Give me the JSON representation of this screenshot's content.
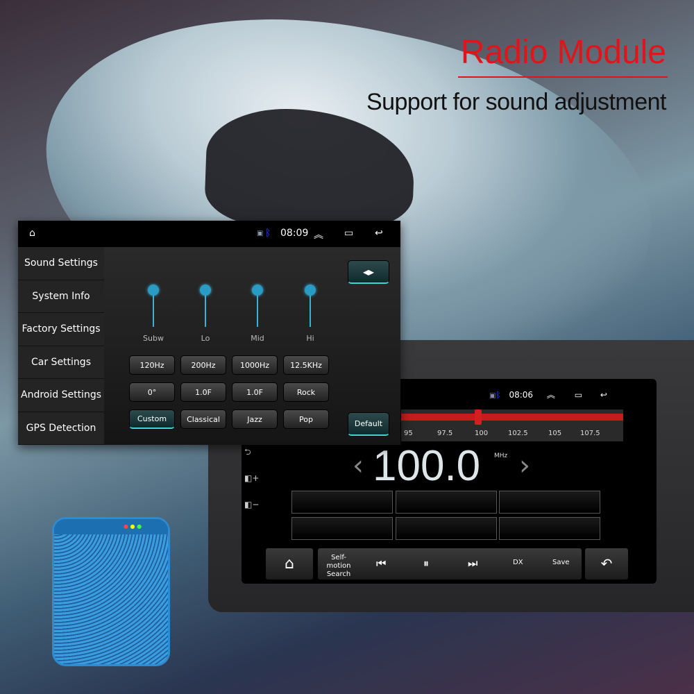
{
  "headline": {
    "title": "Radio Module",
    "subtitle": "Support for sound adjustment",
    "accent": "#e0151b"
  },
  "settings_panel": {
    "status": {
      "time": "08:09",
      "icons": [
        "home-icon",
        "cast-icon",
        "bluetooth-icon",
        "expand-up-icon",
        "recent-apps-icon",
        "back-icon"
      ]
    },
    "sidebar": [
      "Sound Settings",
      "System Info",
      "Factory Settings",
      "Car Settings",
      "Android Settings",
      "GPS Detection"
    ],
    "sliders": [
      {
        "label": "Subw"
      },
      {
        "label": "Lo"
      },
      {
        "label": "Mid"
      },
      {
        "label": "Hi"
      }
    ],
    "row1": [
      "120Hz",
      "200Hz",
      "1000Hz",
      "12.5KHz"
    ],
    "row2": [
      "0°",
      "1.0F",
      "1.0F",
      "Rock"
    ],
    "row3": [
      "Custom",
      "Classical",
      "Jazz",
      "Pop"
    ],
    "selected_preset": "Custom",
    "default_label": "Default",
    "balance_icon": "speaker-balance-icon"
  },
  "radio": {
    "status": {
      "time": "08:06"
    },
    "ticks": [
      "95",
      "97.5",
      "100",
      "102.5",
      "105",
      "107.5"
    ],
    "frequency": "100.0",
    "unit": "MHz",
    "controls": {
      "search": "Self-motion Search",
      "dx": "DX",
      "save": "Save"
    },
    "side_icons": [
      "back-icon",
      "volume-up-icon",
      "volume-down-icon"
    ]
  }
}
